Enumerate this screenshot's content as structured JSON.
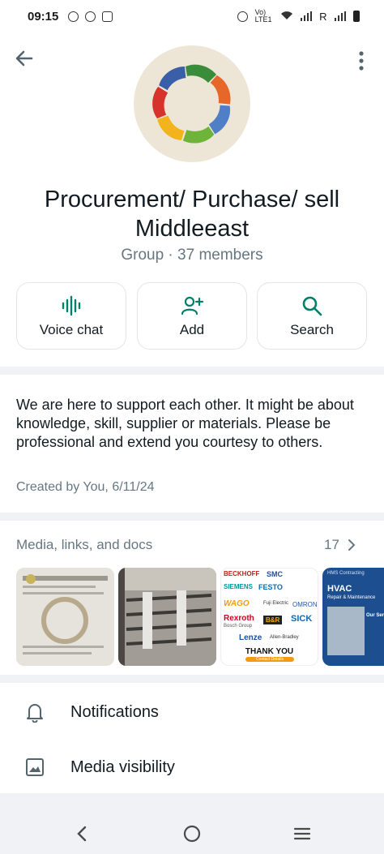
{
  "status_bar": {
    "time": "09:15",
    "network": "Vo) LTE1",
    "carrier": "R"
  },
  "group": {
    "title_line1": "Procurement/ Purchase/ sell",
    "title_line2": "Middleeast",
    "meta": "Group · 37 members"
  },
  "actions": [
    {
      "label": "Voice chat",
      "icon": "waveform-icon"
    },
    {
      "label": "Add",
      "icon": "add-person-icon"
    },
    {
      "label": "Search",
      "icon": "search-icon"
    }
  ],
  "about": {
    "description": "We are here to support each other. It might be about knowledge, skill, supplier or materials. Please be professional and extend you courtesy to others.",
    "created": "Created by You, 6/11/24"
  },
  "media": {
    "header": "Media, links, and docs",
    "count": "17",
    "thumbnails": [
      {
        "kind": "document-scan"
      },
      {
        "kind": "steel-rods-photo"
      },
      {
        "kind": "brand-logo-collage",
        "brands": [
          "BECKHOFF",
          "SMC",
          "SIEMENS",
          "FESTO",
          "WAGO",
          "Fuji Electric",
          "OMRON",
          "Rexroth",
          "Bosch Group",
          "B&R",
          "SICK",
          "Lenze",
          "Allen-Bradley"
        ],
        "caption": "THANK YOU",
        "cta": "Contact Details"
      },
      {
        "kind": "hvac-flyer",
        "tag": "HMS Contracting",
        "title": "HVAC",
        "subtitle": "Repair & Maintenance",
        "side": "Our Ser"
      }
    ]
  },
  "settings": [
    {
      "label": "Notifications",
      "icon": "bell-icon"
    },
    {
      "label": "Media visibility",
      "icon": "image-icon"
    }
  ],
  "colors": {
    "accent": "#008069",
    "muted": "#667781",
    "background": "#f0f2f5"
  }
}
